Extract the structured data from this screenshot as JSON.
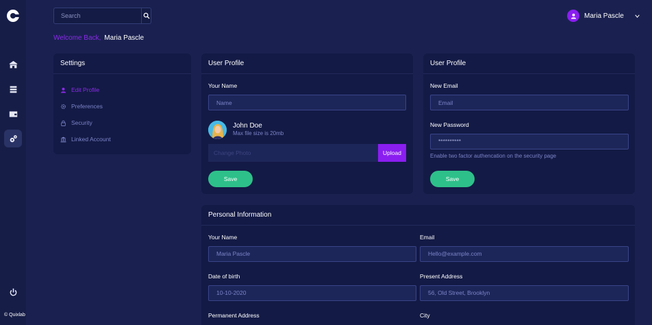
{
  "brand": {
    "copyright": "© Quixlab"
  },
  "sidebar": {
    "items": [
      {
        "icon": "home-icon"
      },
      {
        "icon": "list-icon"
      },
      {
        "icon": "wallet-icon"
      },
      {
        "icon": "settings-gear-icon",
        "active": true
      }
    ],
    "power_icon": "power-icon"
  },
  "search": {
    "placeholder": "Search"
  },
  "user": {
    "name": "Maria Pascle"
  },
  "welcome": {
    "greeting": "Welcome Back,",
    "name": "Maria Pascle"
  },
  "settings_card": {
    "title": "Settings",
    "items": [
      {
        "label": "Edit Profile",
        "icon": "user-icon",
        "active": true
      },
      {
        "label": "Preferences",
        "icon": "gear-icon"
      },
      {
        "label": "Security",
        "icon": "lock-icon"
      },
      {
        "label": "Linked Account",
        "icon": "bank-icon"
      }
    ]
  },
  "profile_card": {
    "title": "User Profile",
    "name_label": "Your Name",
    "name_placeholder": "Name",
    "profile_name": "John Doe",
    "profile_sub": "Max file size is 20mb",
    "photo_placeholder": "Change Photo",
    "upload_label": "Upload",
    "save_label": "Save"
  },
  "account_card": {
    "title": "User Profile",
    "email_label": "New Email",
    "email_placeholder": "Email",
    "password_label": "New Password",
    "password_value": "**********",
    "hint": "Enable two factor authencation on the security page",
    "save_label": "Save"
  },
  "personal_card": {
    "title": "Personal Information",
    "fields": {
      "name_label": "Your Name",
      "name_value": "Maria Pascle",
      "email_label": "Email",
      "email_value": "Hello@example.com",
      "dob_label": "Date of birth",
      "dob_value": "10-10-2020",
      "address_label": "Present Address",
      "address_value": "56, Old Street, Brooklyn",
      "perm_label": "Permanent Address",
      "city_label": "City"
    }
  },
  "colors": {
    "background": "#1a2150",
    "card": "#131a45",
    "accent_purple": "#8a1ef0",
    "save_green": "#2ec08a",
    "muted_text": "#7c84c9"
  }
}
